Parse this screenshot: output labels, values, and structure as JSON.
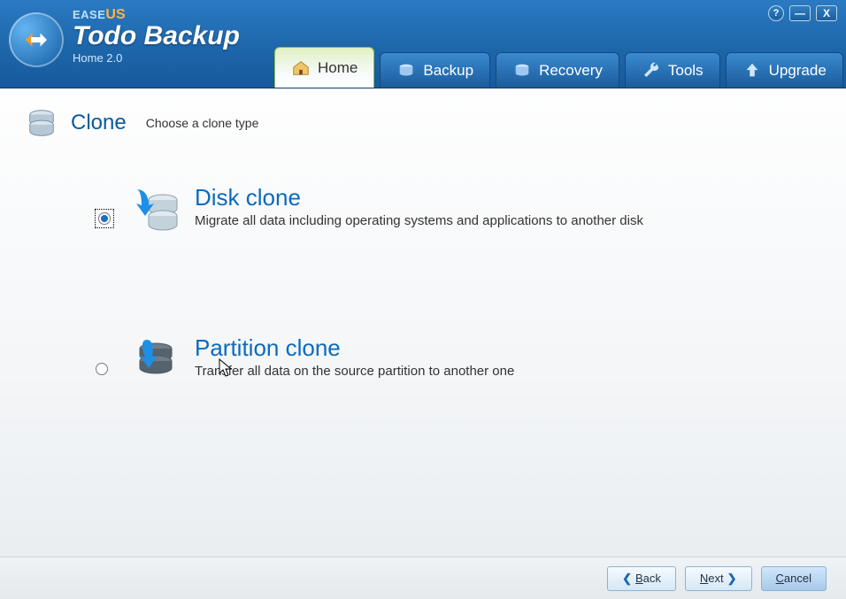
{
  "brand": {
    "ease": "EASE",
    "us": "US",
    "title": "Todo Backup",
    "version": "Home 2.0"
  },
  "win": {
    "help": "?",
    "min": "—",
    "close": "X"
  },
  "tabs": [
    {
      "label": "Home",
      "icon": "house-icon",
      "active": true
    },
    {
      "label": "Backup",
      "icon": "disk-icon"
    },
    {
      "label": "Recovery",
      "icon": "disk-icon"
    },
    {
      "label": "Tools",
      "icon": "wrench-icon"
    },
    {
      "label": "Upgrade",
      "icon": "up-arrow-icon"
    }
  ],
  "page": {
    "title": "Clone",
    "subtitle": "Choose a clone type"
  },
  "options": [
    {
      "key": "disk-clone",
      "title": "Disk clone",
      "desc": "Migrate all data including operating systems and applications to another disk",
      "selected": true
    },
    {
      "key": "partition-clone",
      "title": "Partition clone",
      "desc": "Transfer all data on the source partition to another one",
      "selected": false
    }
  ],
  "footer": {
    "back": {
      "arrow": "❮",
      "ul": "B",
      "rest": "ack"
    },
    "next": {
      "ul": "N",
      "rest": "ext",
      "arrow": "❯"
    },
    "cancel": {
      "ul": "C",
      "rest": "ancel"
    }
  }
}
